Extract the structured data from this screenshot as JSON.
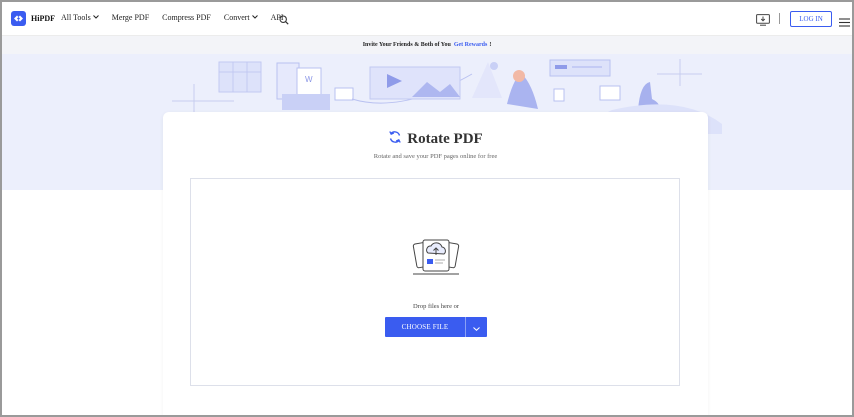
{
  "brand": {
    "name": "HiPDF",
    "accent": "#3a5cf0"
  },
  "nav": {
    "items": [
      {
        "label": "All Tools",
        "dropdown": true
      },
      {
        "label": "Merge PDF",
        "dropdown": false
      },
      {
        "label": "Compress PDF",
        "dropdown": false
      },
      {
        "label": "Convert",
        "dropdown": true
      },
      {
        "label": "API",
        "dropdown": false
      }
    ],
    "icons": [
      "search-icon",
      "desktop-download-icon",
      "hamburger-menu-icon"
    ],
    "login_label": "LOG IN"
  },
  "banner": {
    "text": "Invite Your Friends & Both of You",
    "link": "Get Rewards",
    "suffix": "!"
  },
  "tool": {
    "title": "Rotate PDF",
    "subtitle": "Rotate and save your PDF pages online for free",
    "drop_text": "Drop files here or",
    "choose_label": "CHOOSE FILE"
  }
}
